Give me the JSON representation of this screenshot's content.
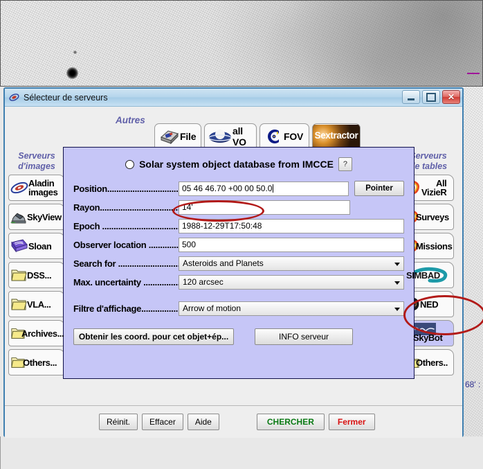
{
  "window": {
    "title": "Sélecteur de serveurs",
    "app_icon": "aladin-galaxy-icon",
    "controls": {
      "minimize": "minimize",
      "maximize": "maximize",
      "close": "close"
    }
  },
  "tabs": {
    "other_label": "Autres",
    "items": [
      {
        "label": "File",
        "icon": "file-box-icon"
      },
      {
        "label": "all VO",
        "icon": "vo-globe-icon"
      },
      {
        "label": "FOV",
        "icon": "fov-c-icon"
      },
      {
        "label": "Sextractor",
        "icon": "sextractor-image-icon"
      }
    ]
  },
  "left_panel": {
    "heading_line1": "Serveurs",
    "heading_line2": "d'images",
    "items": [
      {
        "label": "Aladin images",
        "label1": "Aladin",
        "label2": "images",
        "icon": "aladin-galaxy-icon",
        "selected": false
      },
      {
        "label": "SkyView",
        "label1": "SkyView",
        "label2": "",
        "icon": "telescope-dome-icon",
        "selected": false
      },
      {
        "label": "Sloan",
        "label1": "Sloan",
        "label2": "",
        "icon": "sloan-survey-icon",
        "selected": false
      },
      {
        "label": "DSS...",
        "label1": "DSS...",
        "label2": "",
        "icon": "folder-icon",
        "selected": false
      },
      {
        "label": "VLA...",
        "label1": "VLA...",
        "label2": "",
        "icon": "folder-icon",
        "selected": false
      },
      {
        "label": "Archives...",
        "label1": "Archives...",
        "label2": "",
        "icon": "folder-icon",
        "selected": false
      },
      {
        "label": "Others...",
        "label1": "Others...",
        "label2": "",
        "icon": "folder-icon",
        "selected": false
      }
    ]
  },
  "right_panel": {
    "heading_line1": "Serveurs",
    "heading_line2": "de tables",
    "items": [
      {
        "label": "All VizieR",
        "label1": "All",
        "label2": "VizieR",
        "icon": "vizier-spiral-icon",
        "selected": false
      },
      {
        "label": "Surveys",
        "label1": "Surveys",
        "label2": "",
        "icon": "vizier-spiral-icon",
        "selected": false
      },
      {
        "label": "Missions",
        "label1": "Missions",
        "label2": "",
        "icon": "vizier-spiral-icon",
        "selected": false
      },
      {
        "label": "SIMBAD",
        "label1": "SIMBAD",
        "label2": "",
        "icon": "simbad-icon",
        "selected": false
      },
      {
        "label": "NED",
        "label1": "NED",
        "label2": "",
        "icon": "ned-sphere-icon",
        "selected": false
      },
      {
        "label": "SkyBot",
        "label1": "SkyBot",
        "label2": "",
        "icon": "skybot-imcce-icon",
        "selected": true
      },
      {
        "label": "Others..",
        "label1": "Others..",
        "label2": "",
        "icon": "folder-icon",
        "selected": false
      }
    ]
  },
  "dialog": {
    "radio_selected": false,
    "title": "Solar system object database from IMCCE",
    "help_label": "?",
    "fields": [
      {
        "label": "Position...................................",
        "value": "05 46 46.70 +00 00 50.0",
        "type": "text",
        "name": "position"
      },
      {
        "label": "Rayon......................................",
        "value": "14'",
        "type": "text",
        "name": "rayon"
      },
      {
        "label": "Epoch .....................................",
        "value": "1988-12-29T17:50:48",
        "type": "text",
        "name": "epoch"
      },
      {
        "label": "Observer location ...............",
        "value": "500",
        "type": "text",
        "name": "observer-location"
      },
      {
        "label": "Search for ............................",
        "value": "Asteroids and Planets",
        "type": "combo",
        "name": "search-for"
      },
      {
        "label": "Max. uncertainty ................",
        "value": "120 arcsec",
        "type": "combo",
        "name": "max-uncertainty"
      },
      {
        "label": "Filtre d'affichage..................",
        "value": "Arrow of motion",
        "type": "combo",
        "name": "filtre-affichage"
      }
    ],
    "pointer_button": "Pointer",
    "coord_button": "Obtenir les coord. pour cet objet+ép...",
    "info_button": "INFO serveur"
  },
  "footer": {
    "buttons": [
      {
        "label": "Réinit.",
        "style": "normal"
      },
      {
        "label": "Effacer",
        "style": "normal"
      },
      {
        "label": "Aide",
        "style": "normal"
      },
      {
        "label": "CHERCHER",
        "style": "green"
      },
      {
        "label": "Fermer",
        "style": "red"
      }
    ]
  },
  "background": {
    "fov_label": "68' :",
    "image": "astronomical-sky-survey-image"
  },
  "annotations": [
    {
      "name": "epoch-highlight",
      "shape": "ellipse",
      "color": "#b21a18"
    },
    {
      "name": "skybot-highlight",
      "shape": "ellipse",
      "color": "#b21a18"
    }
  ],
  "colors": {
    "dialog_panel": "#c6c6f7",
    "annotation_red": "#b21a18",
    "search_green": "#0a7a14",
    "close_red": "#d81010",
    "heading_purple": "#5f5fa8"
  }
}
